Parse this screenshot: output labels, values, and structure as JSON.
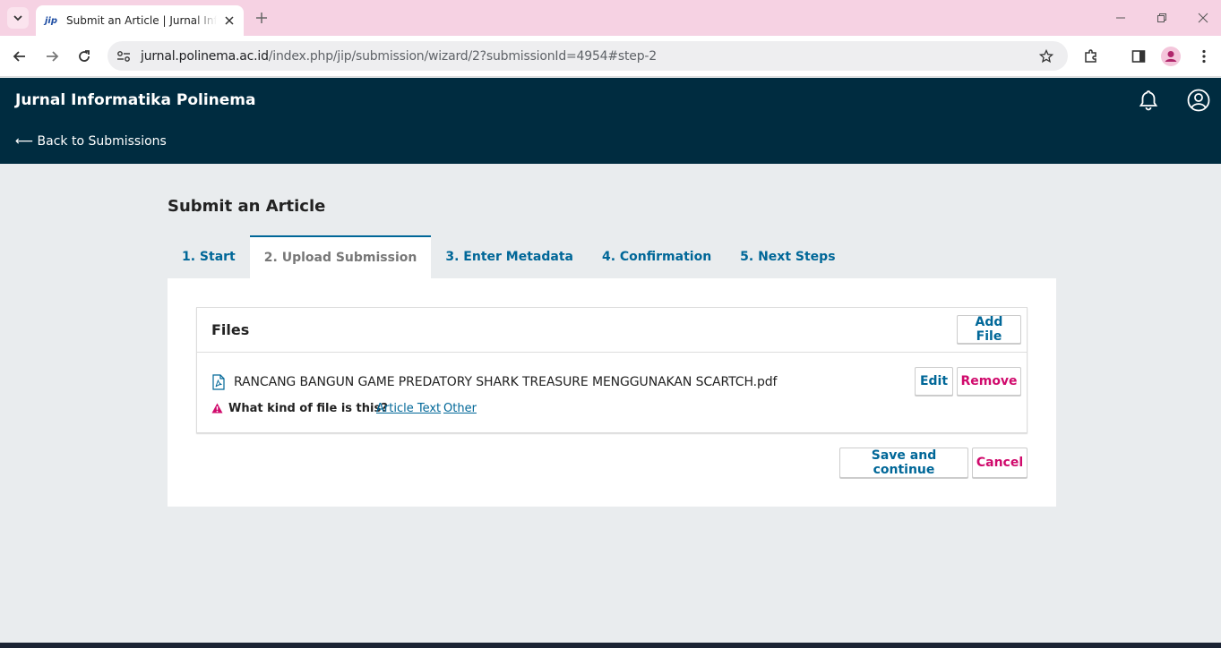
{
  "browser": {
    "tab_title": "Submit an Article | Jurnal Informatika Polinema",
    "tab_favicon": "jip",
    "url_host": "jurnal.polinema.ac.id",
    "url_path": "/index.php/jip/submission/wizard/2?submissionId=4954#step-2",
    "colors": {
      "tabbar": "#f6d2e3",
      "toolbar": "#ffffff"
    }
  },
  "header": {
    "journal_title": "Jurnal Informatika Polinema",
    "back_link": "⟵ Back to Submissions",
    "color": "#002c40"
  },
  "page": {
    "title": "Submit an Article",
    "steps": [
      {
        "label": "1. Start",
        "active": false
      },
      {
        "label": "2. Upload Submission",
        "active": true
      },
      {
        "label": "3. Enter Metadata",
        "active": false
      },
      {
        "label": "4. Confirmation",
        "active": false
      },
      {
        "label": "5. Next Steps",
        "active": false
      }
    ]
  },
  "files": {
    "title": "Files",
    "add_button": "Add File",
    "items": [
      {
        "name": "RANCANG BANGUN GAME PREDATORY SHARK TREASURE MENGGUNAKAN SCARTCH.pdf",
        "icon": "pdf-file-icon",
        "edit_label": "Edit",
        "remove_label": "Remove",
        "kind_question": "What kind of file is this?",
        "kind_options": [
          "Article Text",
          "Other"
        ]
      }
    ]
  },
  "actions": {
    "save_label": "Save and continue",
    "cancel_label": "Cancel"
  },
  "colors": {
    "primary": "#006798",
    "danger": "#d00a6c",
    "background": "#e9ecee"
  }
}
